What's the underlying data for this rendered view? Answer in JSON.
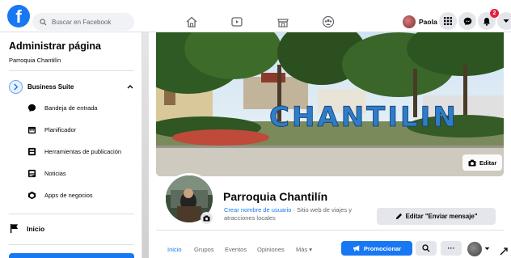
{
  "topbar": {
    "logo_letter": "f",
    "search_placeholder": "Buscar en Facebook",
    "user_name": "Paola",
    "notification_count": "2",
    "icons": [
      "home-icon",
      "watch-icon",
      "marketplace-icon",
      "groups-icon",
      "menu-grid-icon",
      "messenger-icon",
      "bell-icon",
      "account-chevron-icon"
    ]
  },
  "sidebar": {
    "title": "Administrar página",
    "subtitle": "Parroquia Chantilín",
    "business_suite": "Business Suite",
    "items": [
      {
        "label": "Bandeja de entrada",
        "icon": "inbox-icon"
      },
      {
        "label": "Planificador",
        "icon": "calendar-icon"
      },
      {
        "label": "Herramientas de publicación",
        "icon": "publishing-tools-icon"
      },
      {
        "label": "Noticias",
        "icon": "news-icon"
      },
      {
        "label": "Apps de negocios",
        "icon": "business-apps-icon"
      }
    ],
    "home": "Inicio"
  },
  "cover": {
    "sign_text": "CHANTILIN",
    "edit_label": "Editar"
  },
  "page": {
    "name": "Parroquia Chantilín",
    "username_link": "Crear nombre de usuario",
    "category": " · Sitio web de viajes y atracciones locales",
    "edit_message_button": "Editar \"Enviar mensaje\""
  },
  "tabs": {
    "items": [
      "Inicio",
      "Grupos",
      "Eventos",
      "Opiniones",
      "Más ▾"
    ],
    "active_index": 0,
    "promote_label": "Promocionar",
    "more_dots": "···"
  },
  "colors": {
    "accent": "#1877f2",
    "background": "#f0f2f5",
    "badge": "#e41e3f"
  }
}
